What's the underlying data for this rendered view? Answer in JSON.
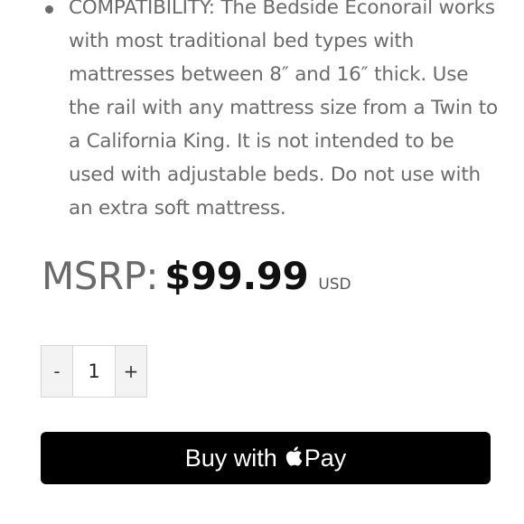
{
  "features": [
    {
      "text": "COMPATIBILITY: The Bedside Econorail works with most traditional bed types with mattresses between 8″ and 16″ thick. Use the rail with any mattress size from a Twin to a California King. It is not intended to be used with adjustable beds. Do not use with an extra soft mattress."
    }
  ],
  "price": {
    "label": "MSRP:",
    "value": "$99.99",
    "currency": "USD"
  },
  "quantity": {
    "decrement_label": "-",
    "value": "1",
    "increment_label": "+"
  },
  "buy_button": {
    "prefix": "Buy with",
    "suffix": "Pay",
    "icon": "apple-icon",
    "background": "#000000",
    "text_color": "#ffffff"
  }
}
